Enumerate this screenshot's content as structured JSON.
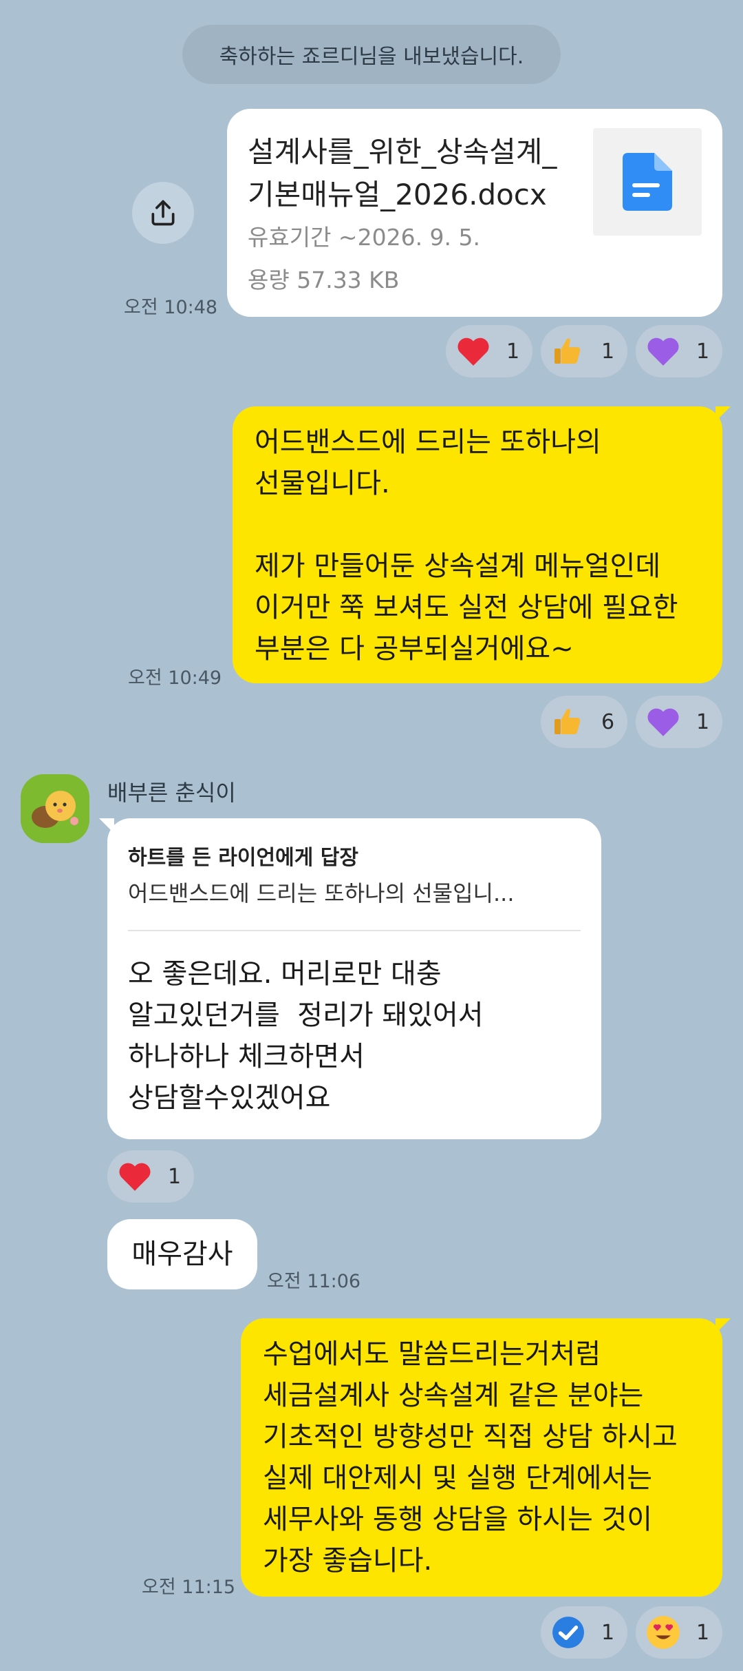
{
  "system_notice": "축하하는 죠르디님을 내보냈습니다.",
  "file_message": {
    "file_name": "설계사를_위한_상속설계_기본매뉴얼_2026.docx",
    "file_name_line1": "설계사를_위한_상속설계_",
    "file_name_line2": "기본매뉴얼_2026.docx",
    "expiry": "유효기간 ~2026. 9. 5.",
    "size": "용량  57.33 KB",
    "time": "오전 10:48",
    "reactions": [
      {
        "icon": "heart-icon",
        "count": "1"
      },
      {
        "icon": "thumbs-up-icon",
        "count": "1"
      },
      {
        "icon": "purple-heart-icon",
        "count": "1"
      }
    ]
  },
  "message_gift": {
    "text": "어드밴스드에 드리는 또하나의\n선물입니다.\n\n제가 만들어둔 상속설계 메뉴얼인데\n이거만 쭉 보셔도 실전 상담에 필요한\n부분은 다 공부되실거에요~",
    "time": "오전 10:49",
    "reactions": [
      {
        "icon": "thumbs-up-icon",
        "count": "6"
      },
      {
        "icon": "purple-heart-icon",
        "count": "1"
      }
    ]
  },
  "sender": {
    "name": "배부른 춘식이",
    "avatar_icon": "chunsik-avatar-icon"
  },
  "reply_message": {
    "reply_to": "하트를 든 라이언에게 답장",
    "quoted": "어드밴스드에 드리는 또하나의 선물입니...",
    "text": "오 좋은데요. 머리로만 대충\n알고있던거를  정리가 돼있어서\n하나하나 체크하면서\n상담할수있겠어요",
    "reactions": [
      {
        "icon": "heart-icon",
        "count": "1"
      }
    ]
  },
  "thanks_message": {
    "text": "매우감사",
    "time": "오전 11:06"
  },
  "final_message": {
    "text": "수업에서도 말씀드리는거처럼\n세금설계사 상속설계 같은 분야는\n기초적인 방향성만 직접 상담 하시고\n실제 대안제시 및 실행 단계에서는\n세무사와 동행 상담을 하시는 것이\n가장 좋습니다.",
    "time": "오전 11:15",
    "reactions": [
      {
        "icon": "check-icon",
        "count": "1"
      },
      {
        "icon": "heart-eyes-icon",
        "count": "1"
      }
    ]
  },
  "colors": {
    "background": "#abc1d1",
    "my_bubble": "#fee500",
    "other_bubble": "#ffffff"
  }
}
